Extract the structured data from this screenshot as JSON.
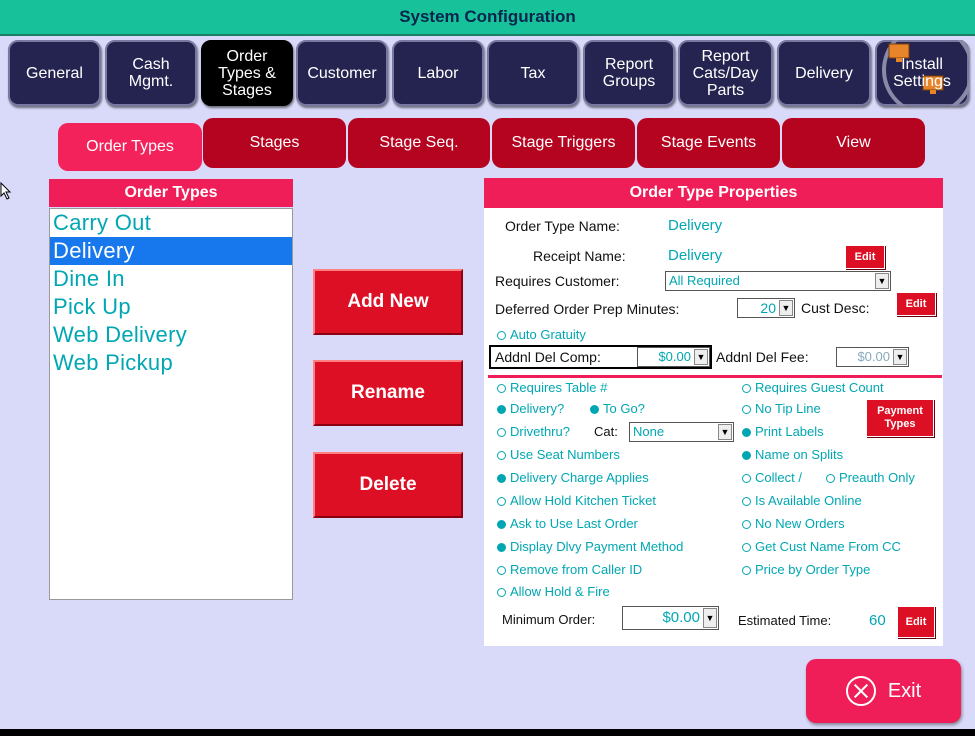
{
  "window_title": "System Configuration",
  "main_tabs": [
    {
      "label": "General"
    },
    {
      "label": "Cash\nMgmt."
    },
    {
      "label": "Order\nTypes &\nStages"
    },
    {
      "label": "Customer"
    },
    {
      "label": "Labor"
    },
    {
      "label": "Tax"
    },
    {
      "label": "Report\nGroups"
    },
    {
      "label": "Report\nCats/Day\nParts"
    },
    {
      "label": "Delivery"
    },
    {
      "label": "Install\nSettings"
    }
  ],
  "sub_tabs": [
    "Order Types",
    "Stages",
    "Stage Seq.",
    "Stage Triggers",
    "Stage Events",
    "View"
  ],
  "order_types": {
    "title": "Order Types",
    "items": [
      "Carry Out",
      "Delivery",
      "Dine In",
      "Pick Up",
      "Web Delivery",
      "Web Pickup"
    ],
    "selected": "Delivery"
  },
  "actions": {
    "add_new": "Add New",
    "rename": "Rename",
    "delete": "Delete"
  },
  "props": {
    "title": "Order Type Properties",
    "order_type_name_label": "Order Type Name:",
    "order_type_name": "Delivery",
    "receipt_name_label": "Receipt Name:",
    "receipt_name": "Delivery",
    "edit_label": "Edit",
    "requires_customer_label": "Requires Customer:",
    "requires_customer": "All Required",
    "deferred_label": "Deferred Order Prep Minutes:",
    "deferred_value": "20",
    "cust_desc_label": "Cust Desc:",
    "auto_gratuity": "Auto Gratuity",
    "addnl_del_comp_label": "Addnl Del Comp:",
    "addnl_del_comp": "$0.00",
    "addnl_del_fee_label": "Addnl Del Fee:",
    "addnl_del_fee": "$0.00",
    "payment_types": "Payment\nTypes",
    "cat_label": "Cat:",
    "cat_value": "None",
    "minimum_order_label": "Minimum Order:",
    "minimum_order": "$0.00",
    "estimated_time_label": "Estimated Time:",
    "estimated_time": "60"
  },
  "options": {
    "requires_table": "Requires Table #",
    "requires_guest_count": "Requires Guest Count",
    "delivery": "Delivery?",
    "to_go": "To Go?",
    "no_tip_line": "No Tip Line",
    "drivethru": "Drivethru?",
    "print_labels": "Print Labels",
    "use_seat_numbers": "Use Seat Numbers",
    "name_on_splits": "Name on Splits",
    "delivery_charge": "Delivery Charge Applies",
    "collect": "Collect /",
    "preauth_only": "Preauth Only",
    "allow_hold_kitchen": "Allow Hold Kitchen Ticket",
    "is_available_online": "Is Available Online",
    "ask_last_order": "Ask to Use Last Order",
    "no_new_orders": "No New Orders",
    "display_dlvy_payment": "Display Dlvy Payment Method",
    "get_cust_name_cc": "Get Cust Name From CC",
    "remove_caller_id": "Remove from Caller ID",
    "price_by_order_type": "Price by Order Type",
    "allow_hold_fire": "Allow Hold & Fire"
  },
  "exit_label": "Exit",
  "colors": {
    "accent_teal": "#00a7b3",
    "header_pink": "#ef1e58",
    "button_red": "#dd0f24",
    "tab_navy": "#252450"
  }
}
